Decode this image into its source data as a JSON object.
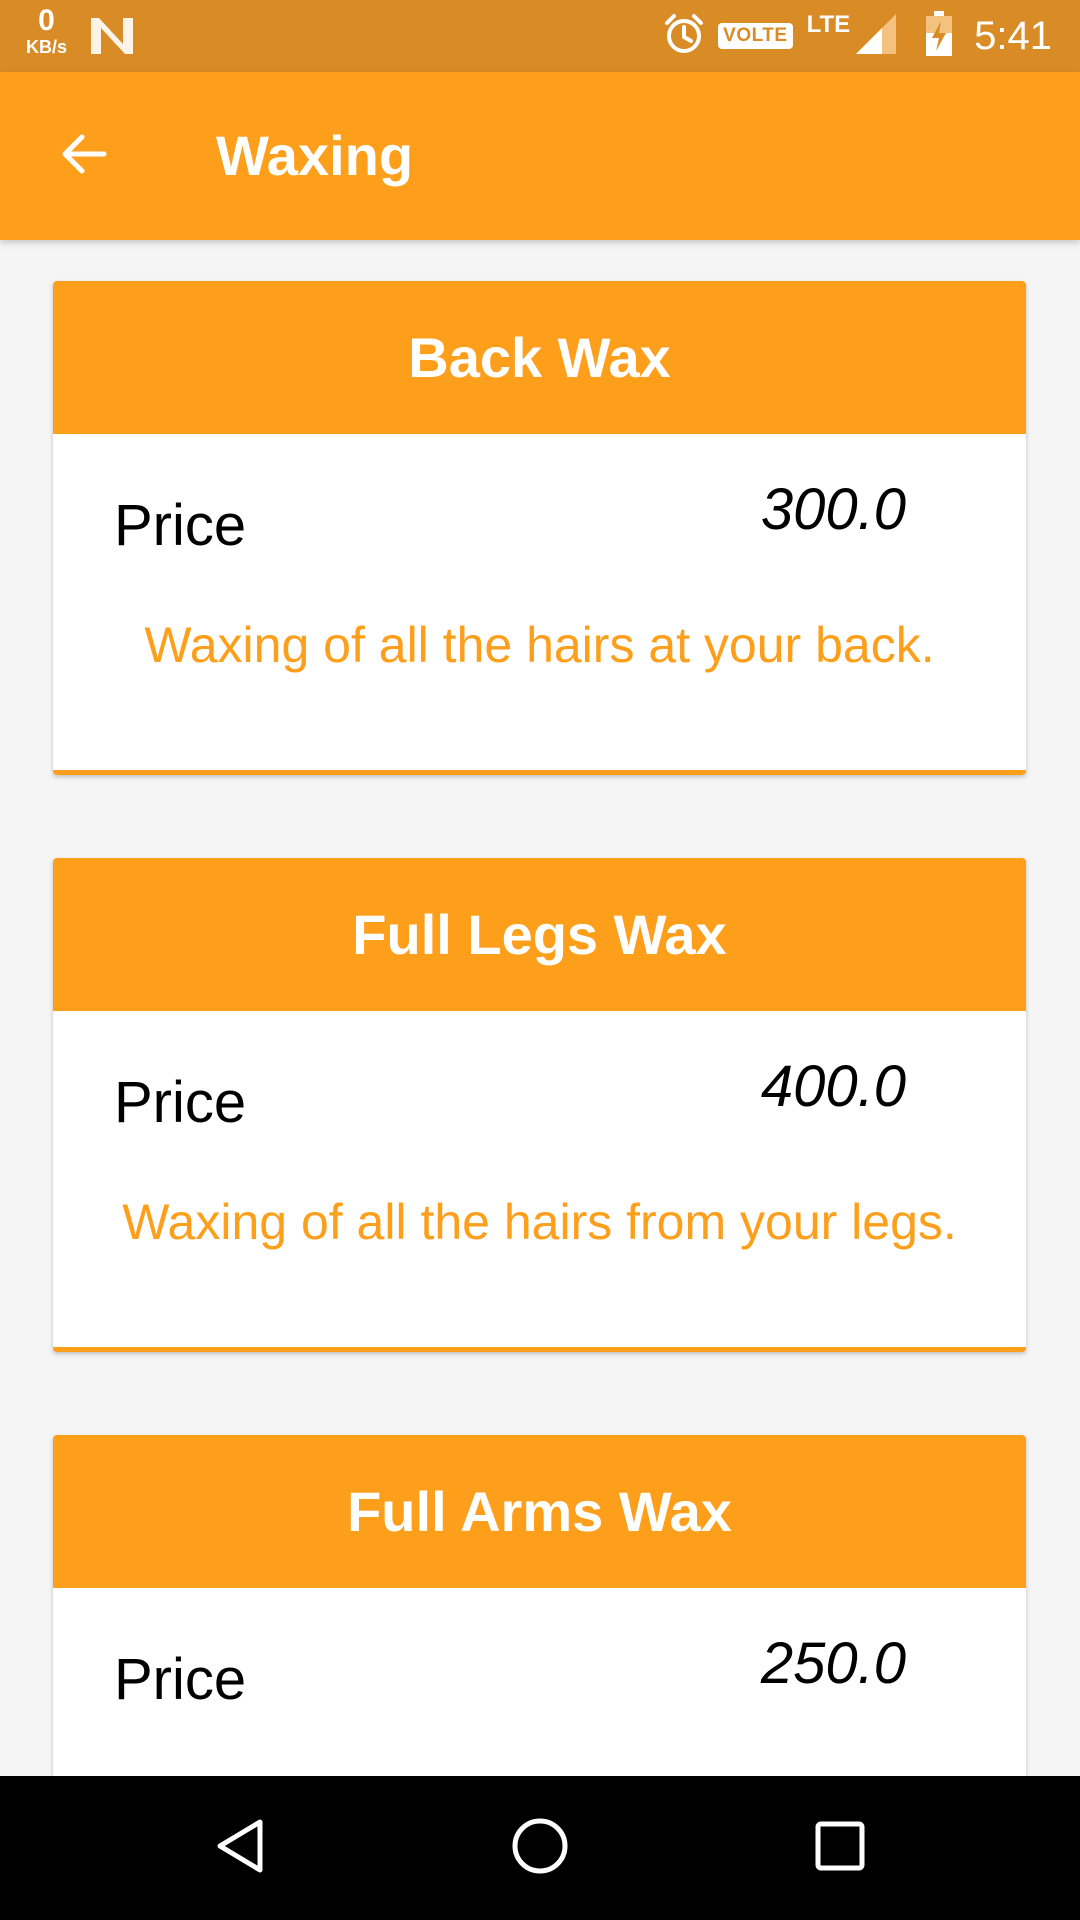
{
  "status_bar": {
    "net_speed_value": "0",
    "net_speed_unit": "KB/s",
    "volte": "VOLTE",
    "lte": "LTE",
    "time": "5:41",
    "icons": [
      "n-notification-icon",
      "alarm-icon",
      "signal-icon",
      "battery-charging-icon"
    ]
  },
  "app_bar": {
    "title": "Waxing",
    "back_icon": "arrow-left-icon"
  },
  "services": [
    {
      "title": "Back Wax",
      "price_label": "Price",
      "price": "300.0",
      "description": "Waxing of all the hairs at your back."
    },
    {
      "title": "Full Legs Wax",
      "price_label": "Price",
      "price": "400.0",
      "description": "Waxing of all the hairs from your legs."
    },
    {
      "title": "Full Arms Wax",
      "price_label": "Price",
      "price": "250.0",
      "description": ""
    }
  ],
  "nav_bar": {
    "icons": [
      "back-triangle-icon",
      "home-circle-icon",
      "recents-square-icon"
    ]
  },
  "colors": {
    "status_bar": "#d98b26",
    "accent": "#fe9f1c",
    "background": "#f5f5f5",
    "nav_bar": "#000000"
  }
}
